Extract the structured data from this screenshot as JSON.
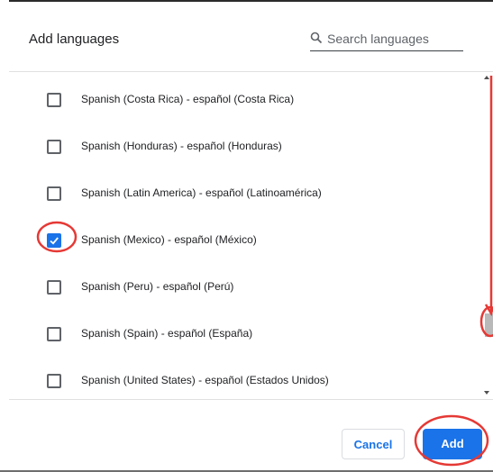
{
  "dialog": {
    "title": "Add languages",
    "search": {
      "placeholder": "Search languages",
      "icon": "search-icon"
    }
  },
  "languages": [
    {
      "label": "Spanish (Costa Rica) - español (Costa Rica)",
      "checked": false
    },
    {
      "label": "Spanish (Honduras) - español (Honduras)",
      "checked": false
    },
    {
      "label": "Spanish (Latin America) - español (Latinoamérica)",
      "checked": false
    },
    {
      "label": "Spanish (Mexico) - español (México)",
      "checked": true
    },
    {
      "label": "Spanish (Peru) - español (Perú)",
      "checked": false
    },
    {
      "label": "Spanish (Spain) - español (España)",
      "checked": false
    },
    {
      "label": "Spanish (United States) - español (Estados Unidos)",
      "checked": false
    }
  ],
  "footer": {
    "cancel_label": "Cancel",
    "add_label": "Add"
  },
  "colors": {
    "accent": "#1a73e8",
    "annotation": "#e53935"
  }
}
